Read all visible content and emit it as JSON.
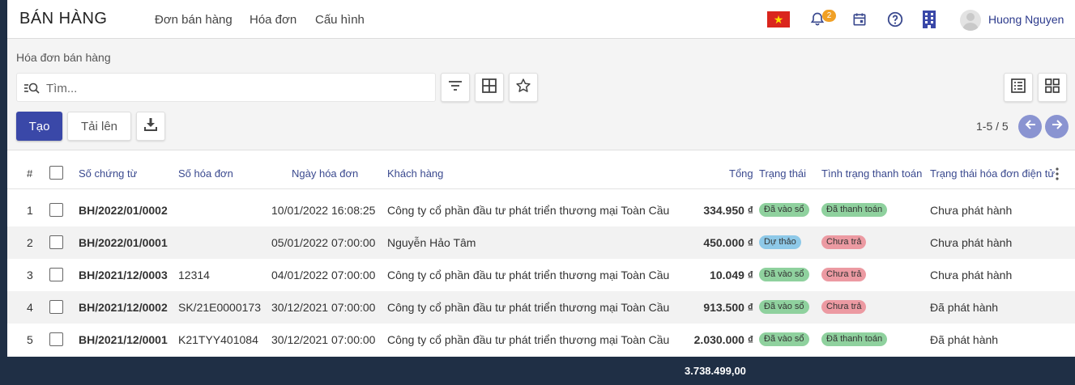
{
  "app": {
    "brand": "BÁN HÀNG",
    "menu": [
      "Đơn bán hàng",
      "Hóa đơn",
      "Cấu hình"
    ],
    "notification_count": "2",
    "user_name": "Huong Nguyen",
    "accent_color": "#3a48a8"
  },
  "control": {
    "breadcrumb": "Hóa đơn bán hàng",
    "search_placeholder": "Tìm...",
    "create_label": "Tạo",
    "upload_label": "Tải lên",
    "pager_text": "1-5 / 5"
  },
  "table": {
    "headers": {
      "index": "#",
      "doc_no": "Số chứng từ",
      "invoice_no": "Số hóa đơn",
      "invoice_date": "Ngày hóa đơn",
      "customer": "Khách hàng",
      "total": "Tổng",
      "status": "Trạng thái",
      "payment_status": "Tình trạng thanh toán",
      "einvoice_status": "Trạng thái hóa đơn điện tử"
    },
    "rows": [
      {
        "index": "1",
        "doc_no": "BH/2022/01/0002",
        "invoice_no": "",
        "invoice_date": "10/01/2022 16:08:25",
        "customer": "Công ty cổ phần đầu tư phát triển thương mại Toàn Cầu",
        "total": "334.950 ₫",
        "status": "Đã vào sổ",
        "payment_status": "Đã thanh toán",
        "einvoice_status": "Chưa phát hành"
      },
      {
        "index": "2",
        "doc_no": "BH/2022/01/0001",
        "invoice_no": "",
        "invoice_date": "05/01/2022 07:00:00",
        "customer": "Nguyễn Hảo Tâm",
        "total": "450.000 ₫",
        "status": "Dự thảo",
        "payment_status": "Chưa trả",
        "einvoice_status": "Chưa phát hành"
      },
      {
        "index": "3",
        "doc_no": "BH/2021/12/0003",
        "invoice_no": "12314",
        "invoice_date": "04/01/2022 07:00:00",
        "customer": "Công ty cổ phần đầu tư phát triển thương mại Toàn Cầu",
        "total": "10.049 ₫",
        "status": "Đã vào sổ",
        "payment_status": "Chưa trả",
        "einvoice_status": "Chưa phát hành"
      },
      {
        "index": "4",
        "doc_no": "BH/2021/12/0002",
        "invoice_no": "SK/21E0000173",
        "invoice_date": "30/12/2021 07:00:00",
        "customer": "Công ty cổ phần đầu tư phát triển thương mại Toàn Cầu",
        "total": "913.500 ₫",
        "status": "Đã vào sổ",
        "payment_status": "Chưa trả",
        "einvoice_status": "Đã phát hành"
      },
      {
        "index": "5",
        "doc_no": "BH/2021/12/0001",
        "invoice_no": "K21TYY401084",
        "invoice_date": "30/12/2021 07:00:00",
        "customer": "Công ty cổ phần đầu tư phát triển thương mại Toàn Cầu",
        "total": "2.030.000 ₫",
        "status": "Đã vào sổ",
        "payment_status": "Đã thanh toán",
        "einvoice_status": "Đã phát hành"
      }
    ],
    "grand_total": "3.738.499,00",
    "status_colors": {
      "Đã vào sổ": "#8fd19e",
      "Dự thảo": "#8ec9e8",
      "Đã thanh toán": "#8fd19e",
      "Chưa trả": "#ec9aa2"
    }
  }
}
